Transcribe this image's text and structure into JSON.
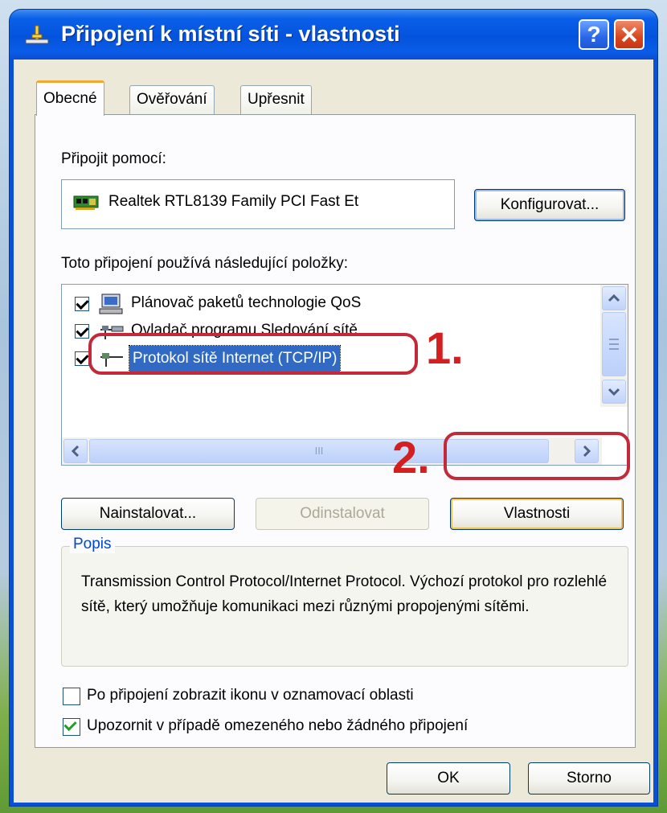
{
  "window": {
    "title": "Připojení k místní síti - vlastnosti",
    "help_button": "?",
    "close_button": "X"
  },
  "tabs": [
    {
      "label": "Obecné",
      "active": true
    },
    {
      "label": "Ověřování",
      "active": false
    },
    {
      "label": "Upřesnit",
      "active": false
    }
  ],
  "connect_using": {
    "label": "Připojit pomocí:",
    "adapter_name": "Realtek RTL8139 Family PCI Fast Et",
    "configure_button": "Konfigurovat..."
  },
  "components": {
    "label": "Toto připojení používá následující položky:",
    "items": [
      {
        "label": "Plánovač paketů technologie QoS",
        "checked": true,
        "icon": "qos-icon"
      },
      {
        "label": "Ovladač programu Sledování sítě",
        "checked": true,
        "icon": "network-monitor-icon"
      },
      {
        "label": "Protokol sítě Internet (TCP/IP)",
        "checked": true,
        "icon": "protocol-icon",
        "selected": true
      }
    ],
    "scroll_thumb_grip": "III"
  },
  "buttons": {
    "install": "Nainstalovat...",
    "uninstall": "Odinstalovat",
    "properties": "Vlastnosti",
    "ok": "OK",
    "cancel": "Storno"
  },
  "description": {
    "title": "Popis",
    "text": "Transmission Control Protocol/Internet Protocol. Výchozí protokol pro rozlehlé sítě, který umožňuje komunikaci mezi různými propojenými sítěmi."
  },
  "options": [
    {
      "label": "Po připojení zobrazit ikonu v oznamovací oblasti",
      "checked": false
    },
    {
      "label": "Upozornit v případě omezeného nebo žádného připojení",
      "checked": true
    }
  ],
  "annotations": {
    "step1": "1.",
    "step2": "2.",
    "color": "#d41f1f"
  },
  "colors": {
    "titlebar": "#0453dd",
    "client_bg": "#ece9d8",
    "selection": "#316ac5",
    "group_title": "#0046d5"
  }
}
